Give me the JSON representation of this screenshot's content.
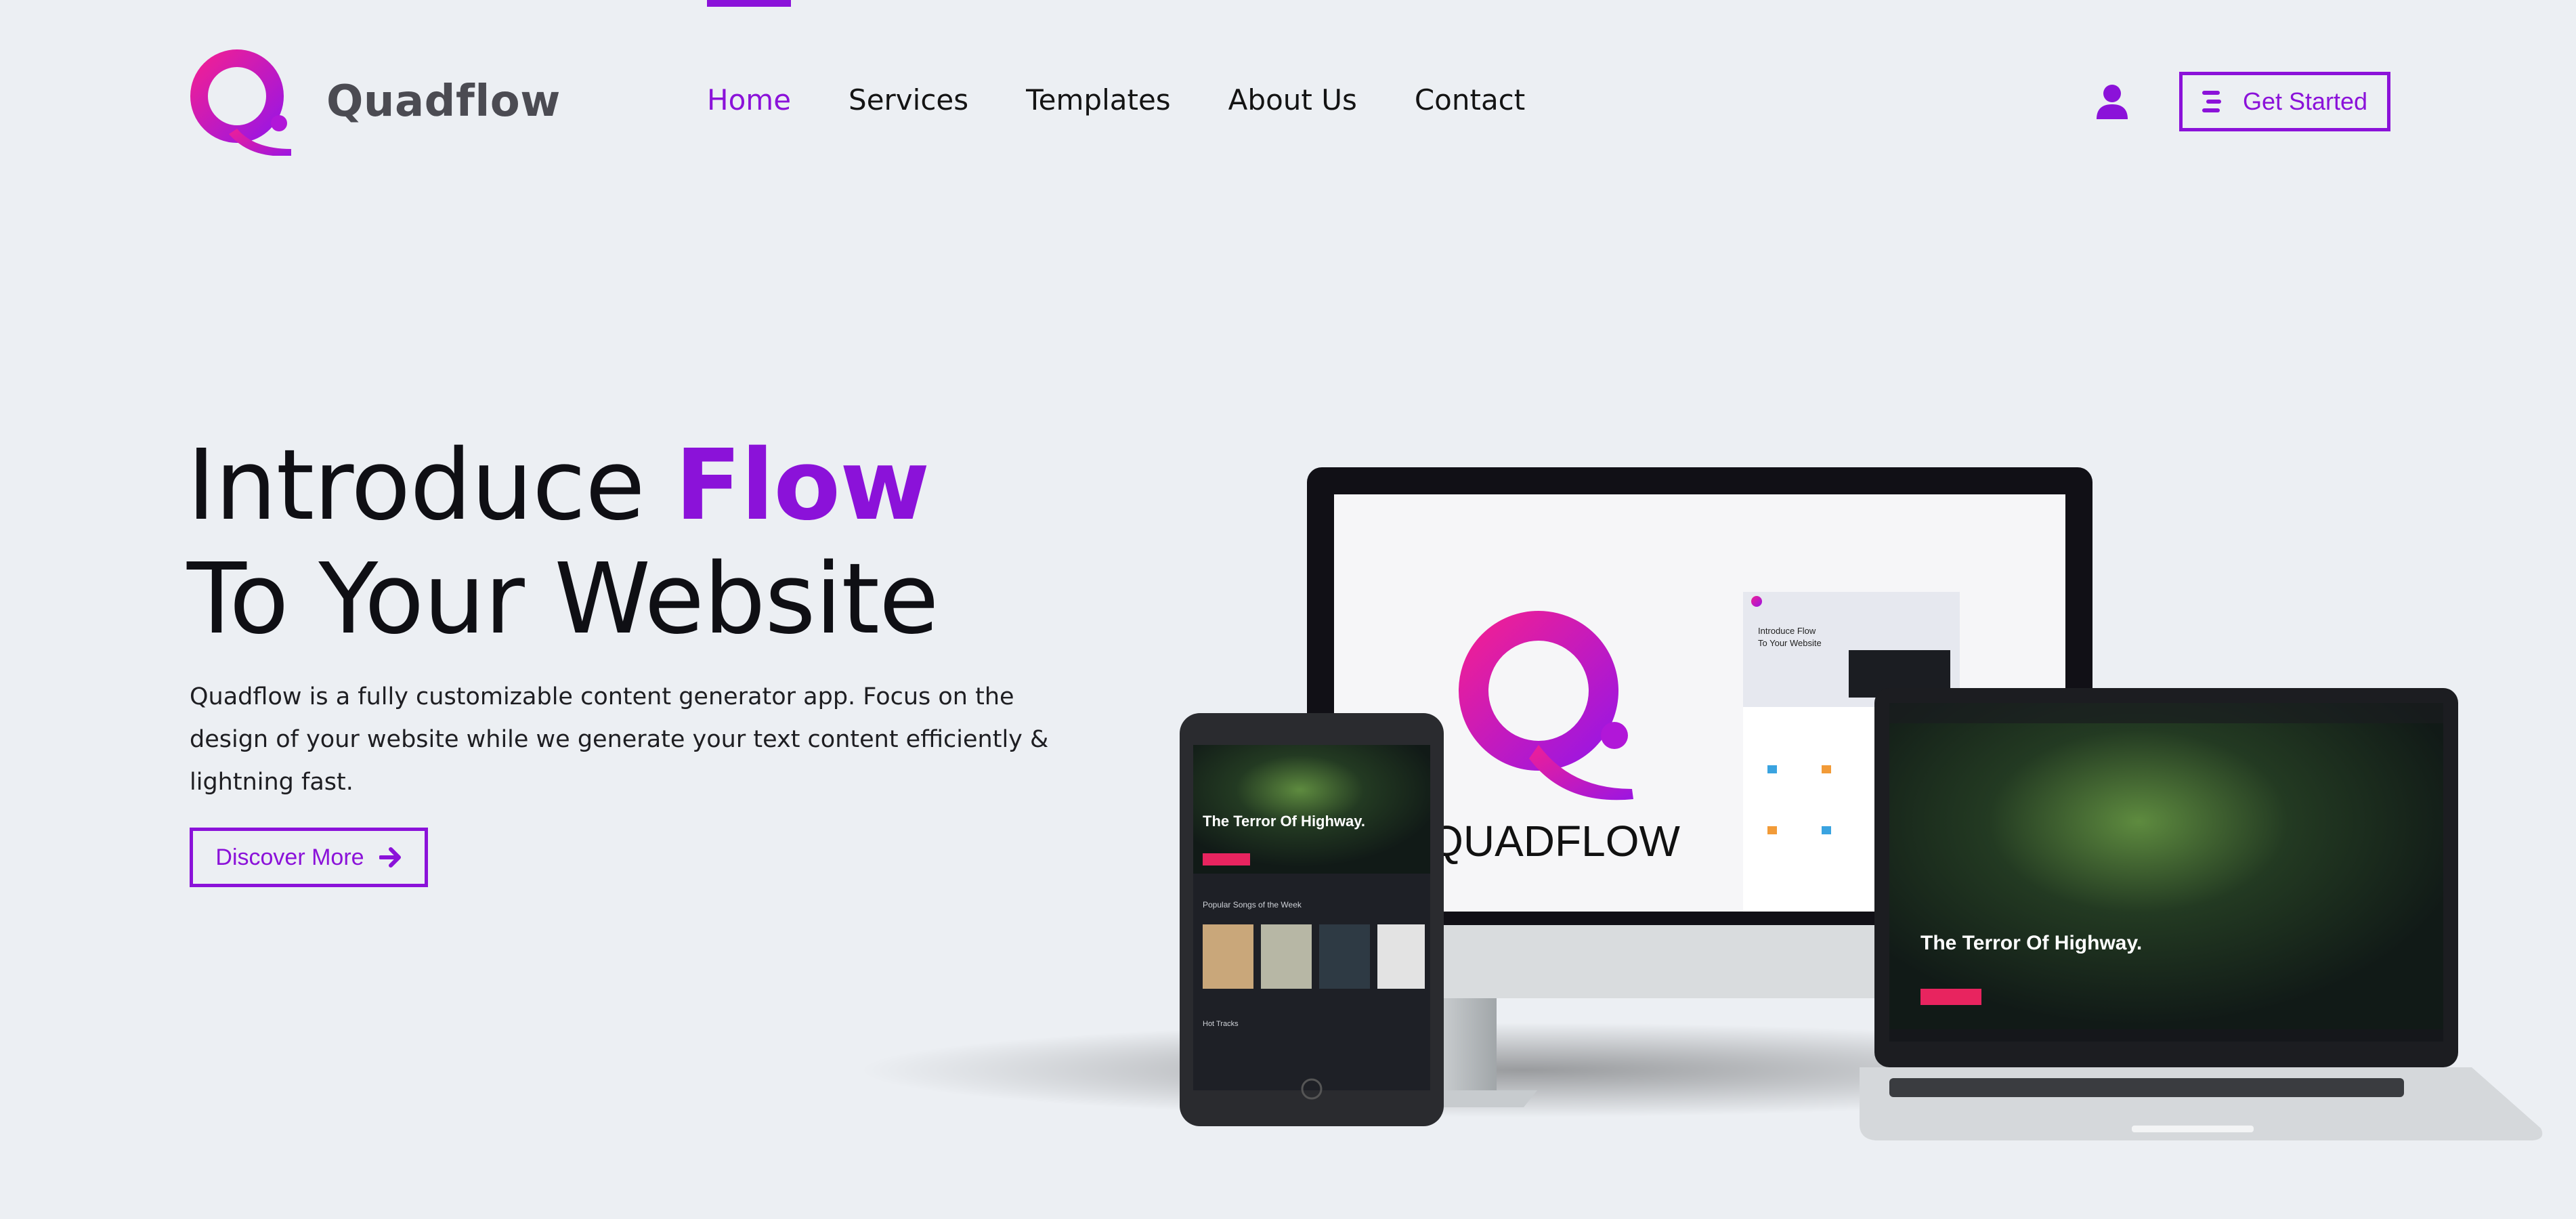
{
  "brand": {
    "name": "Quadflow",
    "accent_color": "#8b12d9",
    "logo_gradient": [
      "#e91e9a",
      "#9a16e0"
    ]
  },
  "nav": {
    "items": [
      {
        "label": "Home",
        "active": true
      },
      {
        "label": "Services",
        "active": false
      },
      {
        "label": "Templates",
        "active": false
      },
      {
        "label": "About Us",
        "active": false
      },
      {
        "label": "Contact",
        "active": false
      }
    ]
  },
  "header": {
    "user_icon": "user-icon",
    "cta_label": "Get Started",
    "cta_icon": "menu-lines-icon"
  },
  "hero": {
    "title_part1": "Introduce ",
    "title_accent": "Flow",
    "title_line2": "To Your Website",
    "description": "Quadflow is a fully customizable content generator app. Focus on the design of your website while we generate your text content efficiently & lightning fast.",
    "button_label": "Discover More",
    "button_icon": "arrow-right-icon"
  },
  "mockup": {
    "monitor_logo_text": "QUADFLOW",
    "site_heading": "The Terror Of Highway.",
    "tablet_section": "Popular Songs of the Week",
    "tablet_section2": "Hot Tracks",
    "mini_intro_line1": "Introduce Flow",
    "mini_intro_line2": "To Your Website"
  }
}
